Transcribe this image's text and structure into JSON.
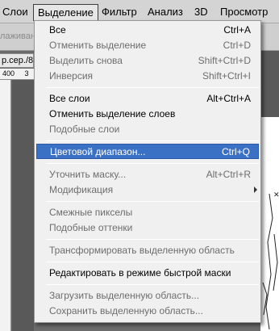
{
  "menubar": {
    "items": [
      "Слои",
      "Выделение",
      "Фильтр",
      "Анализ",
      "3D",
      "Просмотр"
    ],
    "active": "Выделение"
  },
  "options_bar": {
    "text": "лаживание"
  },
  "document": {
    "tab": "р.сер./8",
    "ruler_label": "400",
    "ruler_label2": "3"
  },
  "menu": {
    "items": [
      {
        "label": "Все",
        "shortcut": "Ctrl+A",
        "enabled": true
      },
      {
        "label": "Отменить выделение",
        "shortcut": "Ctrl+D",
        "enabled": false
      },
      {
        "label": "Выделить снова",
        "shortcut": "Shift+Ctrl+D",
        "enabled": false
      },
      {
        "label": "Инверсия",
        "shortcut": "Shift+Ctrl+I",
        "enabled": false
      },
      {
        "label": "Все слои",
        "shortcut": "Alt+Ctrl+A",
        "enabled": true
      },
      {
        "label": "Отменить выделение слоев",
        "shortcut": "",
        "enabled": true
      },
      {
        "label": "Подобные слои",
        "shortcut": "",
        "enabled": false
      },
      {
        "label": "Цветовой диапазон...",
        "shortcut": "Ctrl+Q",
        "enabled": true,
        "highlighted": true
      },
      {
        "label": "Уточнить маску...",
        "shortcut": "Alt+Ctrl+R",
        "enabled": false
      },
      {
        "label": "Модификация",
        "shortcut": "",
        "enabled": false,
        "submenu": true
      },
      {
        "label": "Смежные пикселы",
        "shortcut": "",
        "enabled": false
      },
      {
        "label": "Подобные оттенки",
        "shortcut": "",
        "enabled": false
      },
      {
        "label": "Трансформировать выделенную область",
        "shortcut": "",
        "enabled": false
      },
      {
        "label": "Редактировать в режиме быстрой маски",
        "shortcut": "",
        "enabled": true
      },
      {
        "label": "Загрузить выделенную область...",
        "shortcut": "",
        "enabled": false
      },
      {
        "label": "Сохранить выделенную область...",
        "shortcut": "",
        "enabled": false
      }
    ]
  },
  "colors": {
    "highlight": "#3b71c4",
    "menu_bg": "#f0f0f0",
    "disabled_text": "#6d6d6d"
  }
}
